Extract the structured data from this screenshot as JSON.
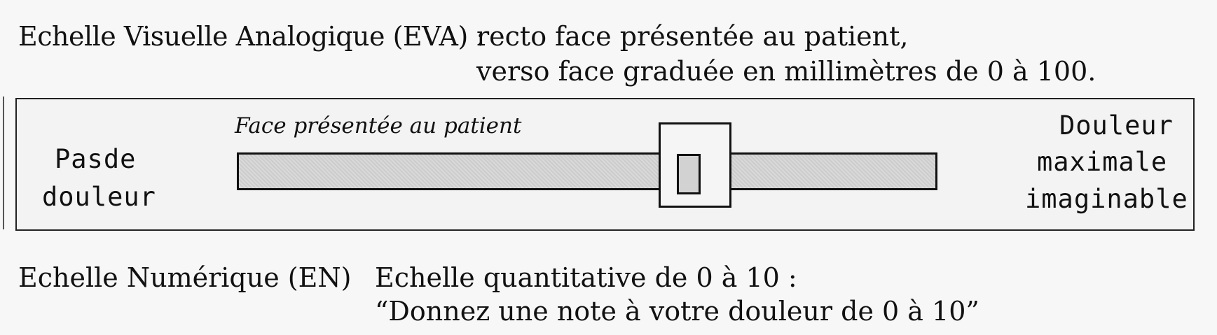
{
  "eva": {
    "label": "Echelle Visuelle Analogique (EVA) :",
    "desc_line1": "recto face présentée au patient,",
    "desc_line2": "verso face graduée en millimètres de 0 à 100."
  },
  "scale": {
    "caption": "Face présentée au patient",
    "left_line1": "Pasde",
    "left_line2": "douleur",
    "right_line1": "Douleur",
    "right_line2": "maximale",
    "right_line3": "imaginable",
    "cursor_position_fraction": 0.65
  },
  "en": {
    "label": "Echelle Numérique (EN)",
    "desc_line1": "Echelle quantitative de 0 à 10 :",
    "desc_line2": "“Donnez une note à votre douleur de 0 à 10”"
  }
}
